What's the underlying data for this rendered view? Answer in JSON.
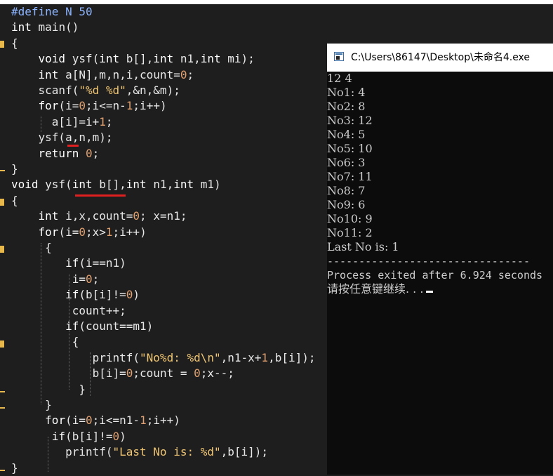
{
  "editor": {
    "lines": [
      "#define N 50",
      "int main()",
      "{",
      "    void ysf(int b[],int n1,int mi);",
      "    int a[N],m,n,i,count=0;",
      "    scanf(\"%d %d\",&n,&m);",
      "    for(i=0;i<=n-1;i++)",
      "      a[i]=i+1;",
      "    ysf(a,n,m);",
      "    return 0;",
      "}",
      "void ysf(int b[],int n1,int m1)",
      "{",
      "    int i,x,count=0; x=n1;",
      "    for(i=0;x>1;i++)",
      "     {",
      "        if(i==n1)",
      "         i=0;",
      "        if(b[i]!=0)",
      "         count++;",
      "        if(count==m1)",
      "         {",
      "            printf(\"No%d: %d\\n\",n1-x+1,b[i]);",
      "            b[i]=0;count = 0;x--;",
      "          }",
      "     }",
      "     for(i=0;i<=n1-1;i++)",
      "      if(b[i]!=0)",
      "        printf(\"Last No is: %d\",b[i]);",
      "}"
    ]
  },
  "console": {
    "title": "C:\\Users\\86147\\Desktop\\未命名4.exe",
    "output": [
      "12 4",
      "No1: 4",
      "No2: 8",
      "No3: 12",
      "No4: 5",
      "No5: 10",
      "No6: 3",
      "No7: 11",
      "No8: 7",
      "No9: 6",
      "No10: 9",
      "No11: 2",
      "Last No is: 1",
      "--------------------------------",
      "Process exited after 6.924 seconds",
      "请按任意键继续. . ."
    ]
  },
  "colors": {
    "editor_bg": "#1e1e1e",
    "console_bg": "#0c0c0c",
    "string": "#f0c674",
    "number": "#e0a070",
    "marker": "#e8b84a",
    "squiggle": "#e02020"
  }
}
